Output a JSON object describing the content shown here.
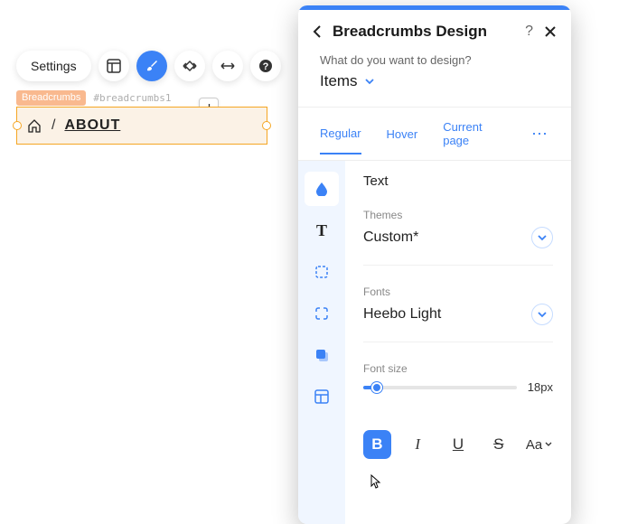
{
  "toolbar": {
    "settings": "Settings"
  },
  "badges": {
    "label": "Breadcrumbs",
    "id": "#breadcrumbs1"
  },
  "breadcrumb": {
    "separator": "/",
    "current": "ABOUT"
  },
  "panel": {
    "title": "Breadcrumbs Design",
    "question": "What do you want to design?",
    "scope": "Items",
    "states": {
      "regular": "Regular",
      "hover": "Hover",
      "current": "Current page"
    },
    "section_title": "Text",
    "themes": {
      "label": "Themes",
      "value": "Custom*"
    },
    "fonts": {
      "label": "Fonts",
      "value": "Heebo Light"
    },
    "font_size": {
      "label": "Font size",
      "value": "18px"
    },
    "format": {
      "bold": "B",
      "italic": "I",
      "underline": "U",
      "strike": "S",
      "case": "Aa"
    }
  }
}
